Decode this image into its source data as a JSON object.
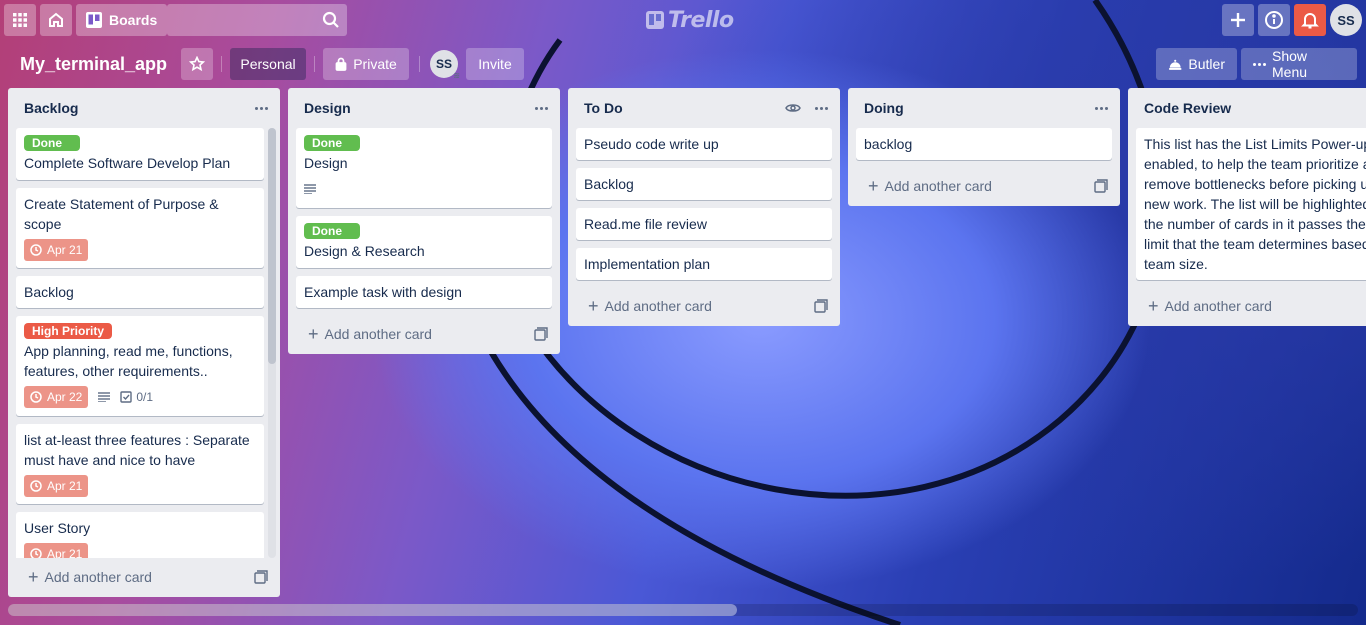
{
  "app": {
    "logo_text": "Trello"
  },
  "topbar": {
    "boards_label": "Boards",
    "search_value": "",
    "avatar_initials": "SS"
  },
  "board": {
    "title": "My_terminal_app",
    "visibility_team": "Personal",
    "visibility_privacy": "Private",
    "member_initials": "SS",
    "invite_label": "Invite",
    "butler_label": "Butler",
    "menu_label": "Show Menu"
  },
  "colors": {
    "label_green": "#61bd4f",
    "label_red": "#eb5a46",
    "due_badge": "#ec9488",
    "notification_red": "#eb5a46"
  },
  "add_card_label": "Add another card",
  "lists": [
    {
      "title": "Backlog",
      "cards": [
        {
          "label": "Done",
          "title": "Complete Software Develop Plan"
        },
        {
          "title": "Create Statement of Purpose & scope",
          "due": "Apr 21"
        },
        {
          "title": "Backlog"
        },
        {
          "label": "High Priority",
          "title": "App planning, read me, functions, features, other requirements..",
          "due": "Apr 22",
          "checklist": "0/1"
        },
        {
          "title": "list at-least three features : Separate must have and nice to have",
          "due": "Apr 21"
        },
        {
          "title": "User Story",
          "due": "Apr 21"
        }
      ]
    },
    {
      "title": "Design",
      "cards": [
        {
          "label": "Done",
          "title": "Design"
        },
        {
          "label": "Done",
          "title": "Design & Research"
        },
        {
          "title": "Example task with design"
        }
      ]
    },
    {
      "title": "To Do",
      "cards": [
        {
          "title": "Pseudo code write up"
        },
        {
          "title": "Backlog"
        },
        {
          "title": "Read.me file review"
        },
        {
          "title": "Implementation plan"
        }
      ]
    },
    {
      "title": "Doing",
      "cards": [
        {
          "title": "backlog"
        }
      ]
    },
    {
      "title": "Code Review",
      "cards": [
        {
          "title": "This list has the List Limits Power-up enabled, to help the team prioritize and remove bottlenecks before picking up new work. The list will be highlighted if the number of cards in it passes the limit that the team determines based on team size."
        }
      ]
    }
  ]
}
